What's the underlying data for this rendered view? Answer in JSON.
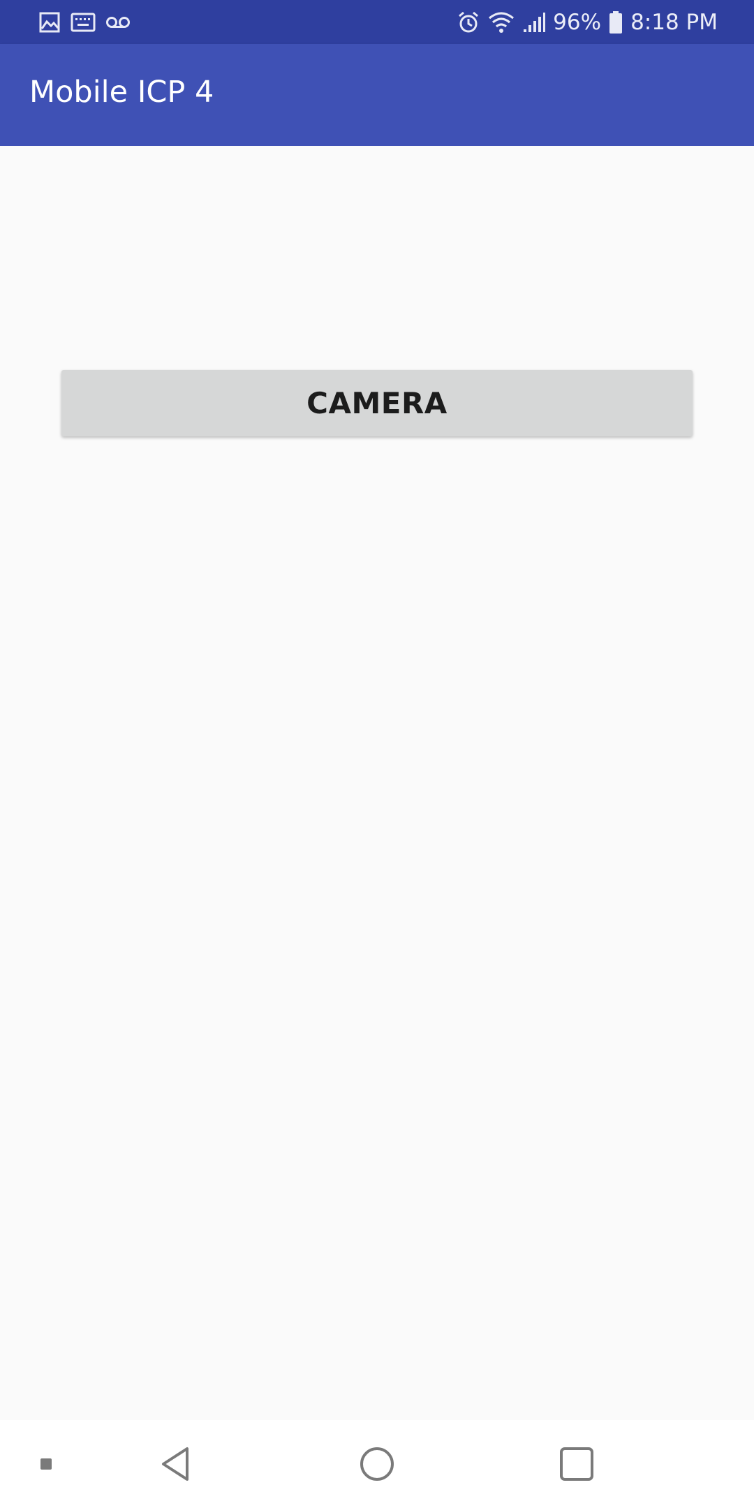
{
  "status_bar": {
    "battery_percent": "96%",
    "time": "8:18 PM",
    "left_icons": [
      "image-icon",
      "keyboard-icon",
      "voicemail-icon"
    ],
    "right_icons": [
      "alarm-icon",
      "wifi-icon",
      "signal-icon",
      "battery-icon"
    ],
    "battery_level": 0.96
  },
  "app_bar": {
    "title": "Mobile ICP 4",
    "color": "#3f51b5"
  },
  "main": {
    "camera_button_label": "CAMERA"
  },
  "nav_bar": {
    "items": [
      "menu-dot-icon",
      "back-icon",
      "home-icon",
      "recents-icon"
    ]
  },
  "colors": {
    "status_bar": "#2f3f9f",
    "app_bar": "#3f51b5",
    "background": "#fafafa",
    "button": "#d6d7d7"
  }
}
